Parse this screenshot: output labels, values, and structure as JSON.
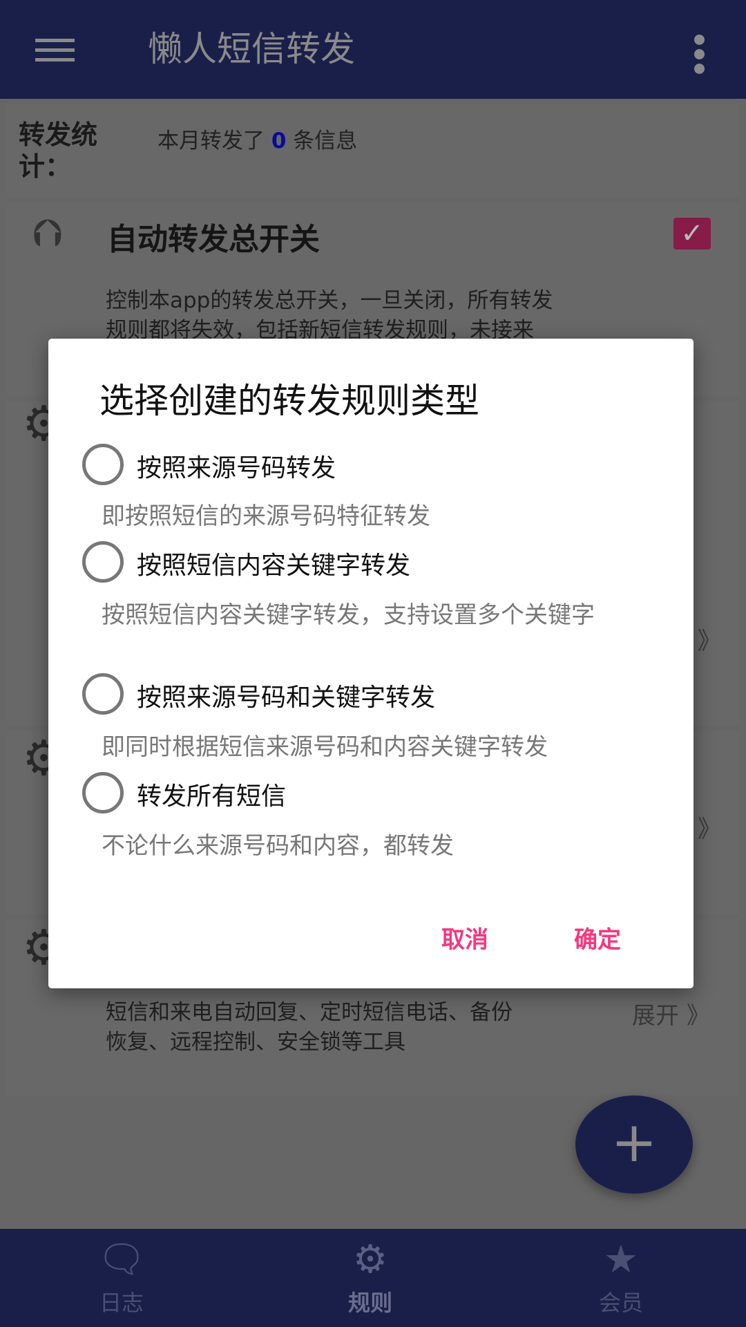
{
  "app": {
    "title": "懒人短信转发"
  },
  "stats": {
    "label": "转发统计：",
    "prefix": "本月转发了",
    "count": "0",
    "suffix": "条信息"
  },
  "master_switch": {
    "title": "自动转发总开关",
    "checked": true,
    "description_lines": [
      "控制本app的转发总开关，一旦关闭，所有转发",
      "规则都将失效，包括新短信转发规则，未接来"
    ]
  },
  "cards": [
    {
      "expand": "》"
    },
    {
      "expand": "》"
    },
    {
      "expand_label": "展开",
      "expand": "》",
      "description_lines": [
        "短信和来电自动回复、定时短信电话、备份",
        "恢复、远程控制、安全锁等工具"
      ]
    }
  ],
  "dialog": {
    "title": "选择创建的转发规则类型",
    "options": [
      {
        "label": "按照来源号码转发",
        "description": "即按照短信的来源号码特征转发",
        "selected": false
      },
      {
        "label": "按照短信内容关键字转发",
        "description": "按照短信内容关键字转发，支持设置多个关键字",
        "selected": false
      },
      {
        "label": "按照来源号码和关键字转发",
        "description": "即同时根据短信来源号码和内容关键字转发",
        "selected": false
      },
      {
        "label": "转发所有短信",
        "description": "不论什么来源号码和内容，都转发",
        "selected": false
      }
    ],
    "cancel": "取消",
    "confirm": "确定"
  },
  "fab": {
    "icon": "plus-icon",
    "label": "+"
  },
  "nav": [
    {
      "label": "日志",
      "icon": "log-alert-icon"
    },
    {
      "label": "规则",
      "icon": "gear-icon",
      "active": true
    },
    {
      "label": "会员",
      "icon": "star-icon"
    }
  ],
  "colors": {
    "primary": "#283593",
    "accent": "#FF4081"
  }
}
